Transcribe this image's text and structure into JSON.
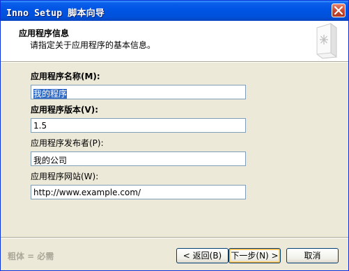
{
  "window": {
    "title": "Inno Setup 脚本向导"
  },
  "header": {
    "title": "应用程序信息",
    "subtitle": "请指定关于应用程序的基本信息。",
    "icon": "notebook-icon"
  },
  "form": {
    "name_label": "应用程序名称(M):",
    "name_value": "我的程序",
    "version_label": "应用程序版本(V):",
    "version_value": "1.5",
    "publisher_label": "应用程序发布者(P):",
    "publisher_value": "我的公司",
    "website_label": "应用程序网站(W):",
    "website_value": "http://www.example.com/"
  },
  "footer": {
    "hint": "粗体 = 必需",
    "back_label": "< 返回(B)",
    "next_label": "下一步(N) >",
    "cancel_label": "取消"
  },
  "colors": {
    "title_bar": "#0054E3",
    "selection": "#316AC5",
    "field_border": "#7F9DB9"
  }
}
